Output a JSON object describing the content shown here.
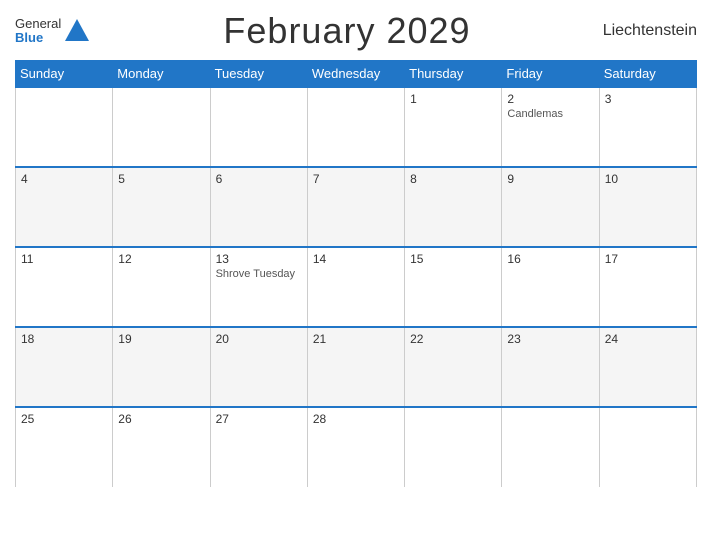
{
  "header": {
    "logo_general": "General",
    "logo_blue": "Blue",
    "title": "February 2029",
    "country": "Liechtenstein"
  },
  "days_of_week": [
    "Sunday",
    "Monday",
    "Tuesday",
    "Wednesday",
    "Thursday",
    "Friday",
    "Saturday"
  ],
  "weeks": [
    [
      {
        "num": "",
        "holiday": ""
      },
      {
        "num": "",
        "holiday": ""
      },
      {
        "num": "",
        "holiday": ""
      },
      {
        "num": "",
        "holiday": ""
      },
      {
        "num": "1",
        "holiday": ""
      },
      {
        "num": "2",
        "holiday": "Candlemas"
      },
      {
        "num": "3",
        "holiday": ""
      }
    ],
    [
      {
        "num": "4",
        "holiday": ""
      },
      {
        "num": "5",
        "holiday": ""
      },
      {
        "num": "6",
        "holiday": ""
      },
      {
        "num": "7",
        "holiday": ""
      },
      {
        "num": "8",
        "holiday": ""
      },
      {
        "num": "9",
        "holiday": ""
      },
      {
        "num": "10",
        "holiday": ""
      }
    ],
    [
      {
        "num": "11",
        "holiday": ""
      },
      {
        "num": "12",
        "holiday": ""
      },
      {
        "num": "13",
        "holiday": "Shrove Tuesday"
      },
      {
        "num": "14",
        "holiday": ""
      },
      {
        "num": "15",
        "holiday": ""
      },
      {
        "num": "16",
        "holiday": ""
      },
      {
        "num": "17",
        "holiday": ""
      }
    ],
    [
      {
        "num": "18",
        "holiday": ""
      },
      {
        "num": "19",
        "holiday": ""
      },
      {
        "num": "20",
        "holiday": ""
      },
      {
        "num": "21",
        "holiday": ""
      },
      {
        "num": "22",
        "holiday": ""
      },
      {
        "num": "23",
        "holiday": ""
      },
      {
        "num": "24",
        "holiday": ""
      }
    ],
    [
      {
        "num": "25",
        "holiday": ""
      },
      {
        "num": "26",
        "holiday": ""
      },
      {
        "num": "27",
        "holiday": ""
      },
      {
        "num": "28",
        "holiday": ""
      },
      {
        "num": "",
        "holiday": ""
      },
      {
        "num": "",
        "holiday": ""
      },
      {
        "num": "",
        "holiday": ""
      }
    ]
  ]
}
